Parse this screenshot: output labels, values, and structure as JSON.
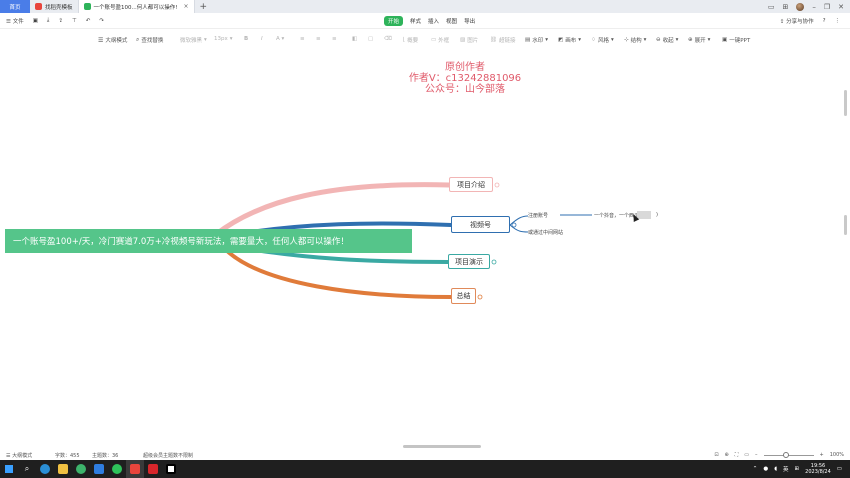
{
  "tabs": {
    "home": "首页",
    "t1": "找稻壳模板",
    "t2": "一个账号盈100...何人都可以操作!"
  },
  "menubar": {
    "file": "文件",
    "items": [
      "开始",
      "样式",
      "插入",
      "视图",
      "导出"
    ],
    "share": "分享与协作",
    "help": "?"
  },
  "toolbar": {
    "outline": "大纲模式",
    "find": "查找替换",
    "font": "微软雅黑",
    "size": "13px",
    "bold": "B",
    "italic": "I",
    "node_mark": "概要",
    "link": "外框",
    "image": "图片",
    "summary": "超链接",
    "watermark": "水印",
    "bg": "画布",
    "style": "风格",
    "structure": "结构",
    "collapse": "收起",
    "expand": "展开",
    "export_ppt": "一键PPT"
  },
  "watermark": {
    "line1": "原创作者",
    "line2": "作者V：c13242881096",
    "line3": "公众号：山今部落"
  },
  "mindmap": {
    "root": "一个账号盈100+/天，冷门赛道7.0万+冷视频号新玩法，需要量大，任何人都可以操作！",
    "branches": [
      "项目介绍",
      "视频号",
      "项目演示",
      "总结"
    ],
    "sub1": "注册账号",
    "sub1b": "一个抖音，一个西瓜视频",
    "sub2": "或通过中间网站"
  },
  "statusbar": {
    "mode": "大纲模式",
    "words_label": "字数：455",
    "topics_label": "主题数：36",
    "hint": "超级会员主题数不限制",
    "zoom": "100%"
  },
  "taskbar": {
    "time": "19:56",
    "date": "2023/8/24",
    "lang": "英"
  },
  "colors": {
    "root": "#55c58a",
    "branch1": "#f2b5b5",
    "branch2": "#2f6fb0",
    "branch3": "#3aa9a3",
    "branch4": "#e07b3a",
    "watermark": "#e05a6a"
  }
}
